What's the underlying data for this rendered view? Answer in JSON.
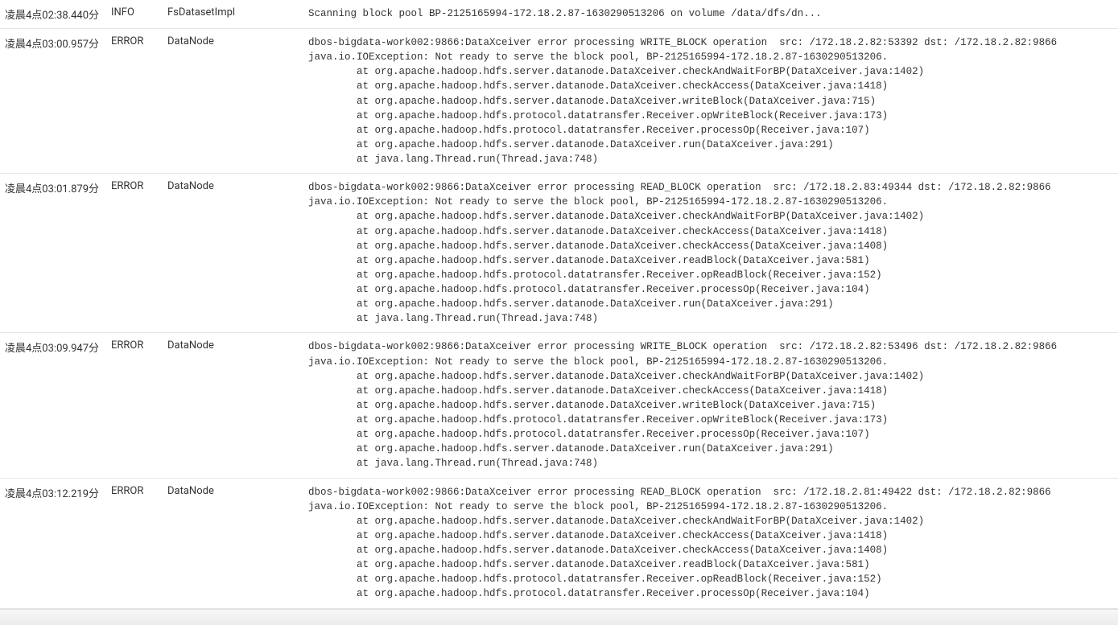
{
  "rows": [
    {
      "time": "凌晨4点02:38.440分",
      "level": "INFO",
      "source": "FsDatasetImpl",
      "message": "Scanning block pool BP-2125165994-172.18.2.87-1630290513206 on volume /data/dfs/dn..."
    },
    {
      "time": "凌晨4点03:00.957分",
      "level": "ERROR",
      "source": "DataNode",
      "message": "dbos-bigdata-work002:9866:DataXceiver error processing WRITE_BLOCK operation  src: /172.18.2.82:53392 dst: /172.18.2.82:9866\njava.io.IOException: Not ready to serve the block pool, BP-2125165994-172.18.2.87-1630290513206.\n        at org.apache.hadoop.hdfs.server.datanode.DataXceiver.checkAndWaitForBP(DataXceiver.java:1402)\n        at org.apache.hadoop.hdfs.server.datanode.DataXceiver.checkAccess(DataXceiver.java:1418)\n        at org.apache.hadoop.hdfs.server.datanode.DataXceiver.writeBlock(DataXceiver.java:715)\n        at org.apache.hadoop.hdfs.protocol.datatransfer.Receiver.opWriteBlock(Receiver.java:173)\n        at org.apache.hadoop.hdfs.protocol.datatransfer.Receiver.processOp(Receiver.java:107)\n        at org.apache.hadoop.hdfs.server.datanode.DataXceiver.run(DataXceiver.java:291)\n        at java.lang.Thread.run(Thread.java:748)"
    },
    {
      "time": "凌晨4点03:01.879分",
      "level": "ERROR",
      "source": "DataNode",
      "message": "dbos-bigdata-work002:9866:DataXceiver error processing READ_BLOCK operation  src: /172.18.2.83:49344 dst: /172.18.2.82:9866\njava.io.IOException: Not ready to serve the block pool, BP-2125165994-172.18.2.87-1630290513206.\n        at org.apache.hadoop.hdfs.server.datanode.DataXceiver.checkAndWaitForBP(DataXceiver.java:1402)\n        at org.apache.hadoop.hdfs.server.datanode.DataXceiver.checkAccess(DataXceiver.java:1418)\n        at org.apache.hadoop.hdfs.server.datanode.DataXceiver.checkAccess(DataXceiver.java:1408)\n        at org.apache.hadoop.hdfs.server.datanode.DataXceiver.readBlock(DataXceiver.java:581)\n        at org.apache.hadoop.hdfs.protocol.datatransfer.Receiver.opReadBlock(Receiver.java:152)\n        at org.apache.hadoop.hdfs.protocol.datatransfer.Receiver.processOp(Receiver.java:104)\n        at org.apache.hadoop.hdfs.server.datanode.DataXceiver.run(DataXceiver.java:291)\n        at java.lang.Thread.run(Thread.java:748)"
    },
    {
      "time": "凌晨4点03:09.947分",
      "level": "ERROR",
      "source": "DataNode",
      "message": "dbos-bigdata-work002:9866:DataXceiver error processing WRITE_BLOCK operation  src: /172.18.2.82:53496 dst: /172.18.2.82:9866\njava.io.IOException: Not ready to serve the block pool, BP-2125165994-172.18.2.87-1630290513206.\n        at org.apache.hadoop.hdfs.server.datanode.DataXceiver.checkAndWaitForBP(DataXceiver.java:1402)\n        at org.apache.hadoop.hdfs.server.datanode.DataXceiver.checkAccess(DataXceiver.java:1418)\n        at org.apache.hadoop.hdfs.server.datanode.DataXceiver.writeBlock(DataXceiver.java:715)\n        at org.apache.hadoop.hdfs.protocol.datatransfer.Receiver.opWriteBlock(Receiver.java:173)\n        at org.apache.hadoop.hdfs.protocol.datatransfer.Receiver.processOp(Receiver.java:107)\n        at org.apache.hadoop.hdfs.server.datanode.DataXceiver.run(DataXceiver.java:291)\n        at java.lang.Thread.run(Thread.java:748)"
    },
    {
      "time": "凌晨4点03:12.219分",
      "level": "ERROR",
      "source": "DataNode",
      "message": "dbos-bigdata-work002:9866:DataXceiver error processing READ_BLOCK operation  src: /172.18.2.81:49422 dst: /172.18.2.82:9866\njava.io.IOException: Not ready to serve the block pool, BP-2125165994-172.18.2.87-1630290513206.\n        at org.apache.hadoop.hdfs.server.datanode.DataXceiver.checkAndWaitForBP(DataXceiver.java:1402)\n        at org.apache.hadoop.hdfs.server.datanode.DataXceiver.checkAccess(DataXceiver.java:1418)\n        at org.apache.hadoop.hdfs.server.datanode.DataXceiver.checkAccess(DataXceiver.java:1408)\n        at org.apache.hadoop.hdfs.server.datanode.DataXceiver.readBlock(DataXceiver.java:581)\n        at org.apache.hadoop.hdfs.protocol.datatransfer.Receiver.opReadBlock(Receiver.java:152)\n        at org.apache.hadoop.hdfs.protocol.datatransfer.Receiver.processOp(Receiver.java:104)"
    }
  ]
}
